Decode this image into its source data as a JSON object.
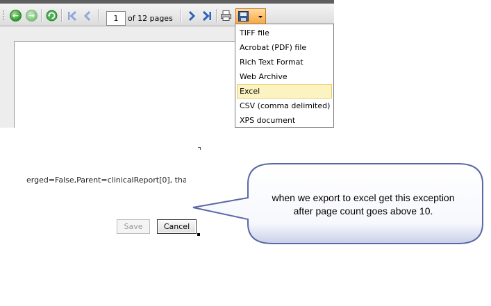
{
  "toolbar": {
    "page_number": "1",
    "page_count_text": "of 12 pages"
  },
  "export_menu": {
    "items": [
      {
        "label": "TIFF file"
      },
      {
        "label": "Acrobat (PDF) file"
      },
      {
        "label": "Rich Text Format"
      },
      {
        "label": "Web Archive"
      },
      {
        "label": "Excel",
        "highlighted": true
      },
      {
        "label": "CSV (comma delimited)"
      },
      {
        "label": "XPS document"
      }
    ]
  },
  "dialog": {
    "error_text": "erged=False,Parent=clinicalReport[0], tha",
    "save_label": "Save",
    "cancel_label": "Cancel"
  },
  "callout": {
    "line1": "when we export to excel get this exception",
    "line2": "after page count goes above 10."
  },
  "colors": {
    "callout_border": "#5a68a8",
    "menu_highlight": "#fbf3c1",
    "export_button": "#f7a53a",
    "nav_blue": "#2f62b8"
  }
}
